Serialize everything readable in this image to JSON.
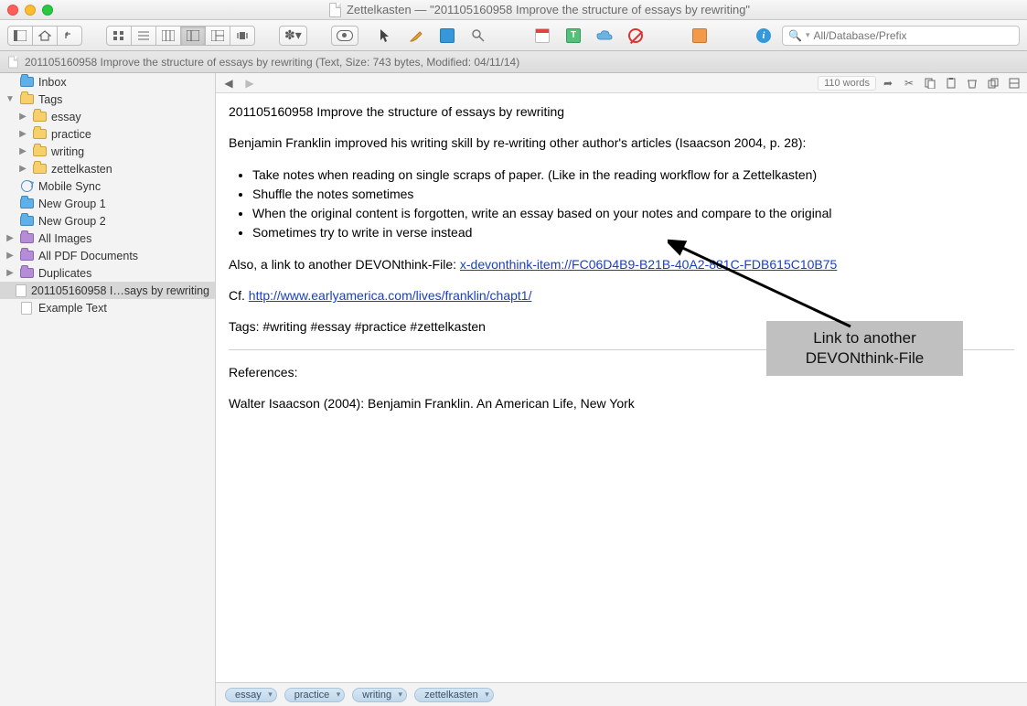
{
  "window": {
    "title": "Zettelkasten — \"201105160958 Improve the structure of essays by rewriting\""
  },
  "search": {
    "placeholder": "All/Database/Prefix"
  },
  "pathbar": {
    "text": "201105160958 Improve the structure of essays by rewriting (Text, Size: 743 bytes, Modified: 04/11/14)"
  },
  "sidebar": {
    "items": [
      {
        "label": "Inbox",
        "indent": 0,
        "icon": "folder-blue",
        "disclosure": ""
      },
      {
        "label": "Tags",
        "indent": 0,
        "icon": "folder-yellow",
        "disclosure": "▼"
      },
      {
        "label": "essay",
        "indent": 1,
        "icon": "folder-yellow",
        "disclosure": "▶"
      },
      {
        "label": "practice",
        "indent": 1,
        "icon": "folder-yellow",
        "disclosure": "▶"
      },
      {
        "label": "writing",
        "indent": 1,
        "icon": "folder-yellow",
        "disclosure": "▶"
      },
      {
        "label": "zettelkasten",
        "indent": 1,
        "icon": "folder-yellow",
        "disclosure": "▶"
      },
      {
        "label": "Mobile Sync",
        "indent": 0,
        "icon": "sync",
        "disclosure": ""
      },
      {
        "label": "New Group 1",
        "indent": 0,
        "icon": "folder-blue",
        "disclosure": ""
      },
      {
        "label": "New Group 2",
        "indent": 0,
        "icon": "folder-blue",
        "disclosure": ""
      },
      {
        "label": "All Images",
        "indent": 0,
        "icon": "folder-purple",
        "disclosure": "▶"
      },
      {
        "label": "All PDF Documents",
        "indent": 0,
        "icon": "folder-purple",
        "disclosure": "▶"
      },
      {
        "label": "Duplicates",
        "indent": 0,
        "icon": "folder-purple",
        "disclosure": "▶"
      },
      {
        "label": "201105160958 I…says by rewriting",
        "indent": 0,
        "icon": "doc",
        "disclosure": "",
        "selected": true
      },
      {
        "label": "Example Text",
        "indent": 0,
        "icon": "doc",
        "disclosure": ""
      }
    ]
  },
  "content_toolbar": {
    "wordcount": "110 words"
  },
  "document": {
    "heading": "201105160958 Improve the structure of essays by rewriting",
    "intro": "Benjamin Franklin improved his writing skill by re-writing other author's articles (Isaacson 2004, p. 28):",
    "bullets": [
      "Take notes when reading on single scraps of paper. (Like in the reading workflow for a Zettelkasten)",
      "Shuffle the notes sometimes",
      "When the original content is forgotten, write an essay based on your notes and compare to the original",
      "Sometimes try to write in verse instead"
    ],
    "link_intro": "Also, a link to another DEVONthink-File: ",
    "devon_link": "x-devonthink-item://FC06D4B9-B21B-40A2-881C-FDB615C10B75",
    "cf_prefix": "Cf. ",
    "cf_link": "http://www.earlyamerica.com/lives/franklin/chapt1/",
    "tags_line": "Tags: #writing #essay #practice #zettelkasten",
    "refs_heading": "References:",
    "reference": "Walter Isaacson (2004): Benjamin Franklin. An American Life, New York"
  },
  "tagbar": {
    "tags": [
      "essay",
      "practice",
      "writing",
      "zettelkasten"
    ]
  },
  "annotation": {
    "text": "Link to another DEVONthink-File"
  }
}
